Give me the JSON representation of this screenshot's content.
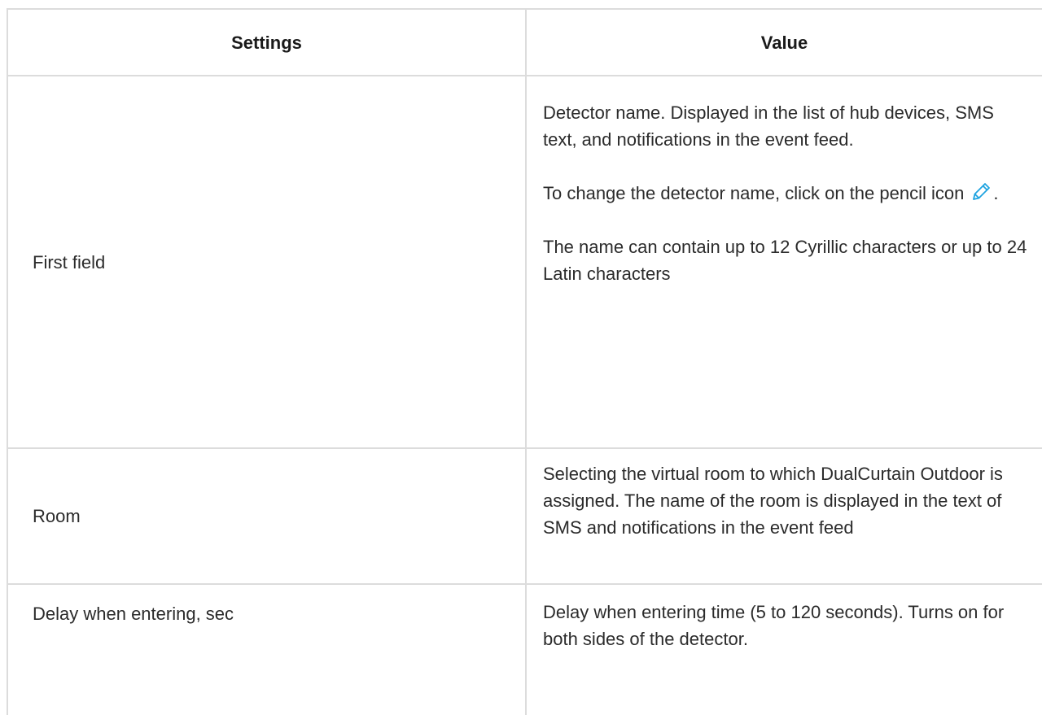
{
  "table": {
    "headers": {
      "settings": "Settings",
      "value": "Value"
    },
    "rows": [
      {
        "setting": "First field",
        "p1": "Detector name. Displayed in the list of hub devices, SMS text, and notifications in the event feed.",
        "p2_before": "To change the detector name, click on the pencil icon",
        "p2_after": ".",
        "p3": "The name can contain up to 12 Cyrillic characters or up to 24 Latin characters"
      },
      {
        "setting": "Room",
        "p1": "Selecting the virtual room to which DualCurtain Outdoor is assigned. The name of the room is displayed in the text of SMS and notifications in the event feed"
      },
      {
        "setting": "Delay when entering, sec",
        "p1": "Delay when entering time (5 to 120 seconds). Turns on for both sides of the detector."
      }
    ]
  },
  "icons": {
    "pencil": "pencil-icon"
  },
  "colors": {
    "pencil_icon": "#1fa3e0",
    "border": "#dcdcdc",
    "text": "#2b2b2b"
  }
}
